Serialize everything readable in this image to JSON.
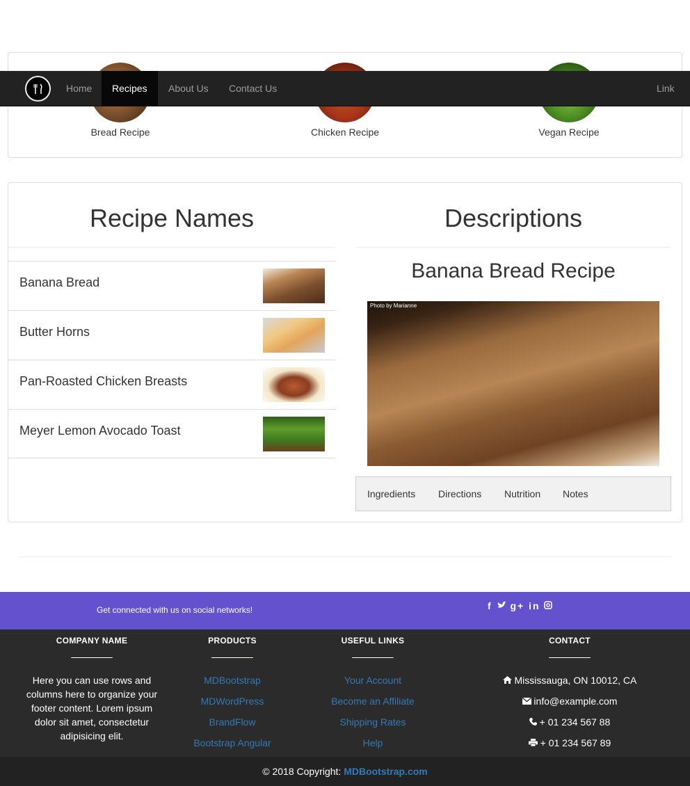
{
  "categories": [
    {
      "label": "Bread Recipe",
      "icon": "bread-image"
    },
    {
      "label": "Chicken Recipe",
      "icon": "chicken-image"
    },
    {
      "label": "Vegan Recipe",
      "icon": "vegan-image"
    }
  ],
  "navbar": {
    "items": [
      "Home",
      "Recipes",
      "About Us",
      "Contact Us"
    ],
    "active": "Recipes",
    "right_link": "Link"
  },
  "main": {
    "left_title": "Recipe Names",
    "right_title": "Descriptions",
    "recipes": [
      "Banana Bread",
      "Butter Horns",
      "Pan-Roasted Chicken Breasts",
      "Meyer Lemon Avocado Toast"
    ],
    "selected_title": "Banana Bread Recipe",
    "photo_credit": "Photo by Marianne",
    "tabs": [
      "Ingredients",
      "Directions",
      "Nutrition",
      "Notes"
    ]
  },
  "social": {
    "text": "Get connected with us on social networks!",
    "icons": [
      "facebook-icon",
      "twitter-icon",
      "google-plus-icon",
      "linkedin-icon",
      "instagram-icon"
    ]
  },
  "footer": {
    "company": {
      "heading": "COMPANY NAME",
      "text": "Here you can use rows and columns here to organize your footer content. Lorem ipsum dolor sit amet, consectetur adipisicing elit."
    },
    "products": {
      "heading": "PRODUCTS",
      "links": [
        "MDBootstrap",
        "MDWordPress",
        "BrandFlow",
        "Bootstrap Angular"
      ]
    },
    "useful": {
      "heading": "USEFUL LINKS",
      "links": [
        "Your Account",
        "Become an Affiliate",
        "Shipping Rates",
        "Help"
      ]
    },
    "contact": {
      "heading": "CONTACT",
      "address": "Mississauga, ON 10012, CA",
      "email": "info@example.com",
      "phone": "+ 01 234 567 88",
      "fax": "+ 01 234 567 89"
    }
  },
  "copyright": {
    "prefix": "© 2018 Copyright:",
    "brand": "MDBootstrap.com"
  }
}
